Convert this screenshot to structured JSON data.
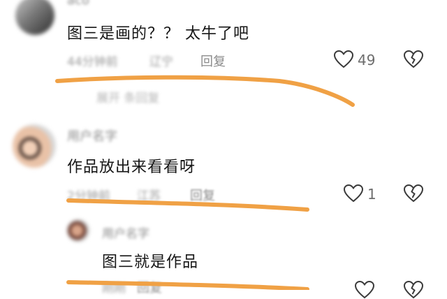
{
  "comments": [
    {
      "username": "aco",
      "text": "图三是画的？？ 太牛了吧",
      "time": "44分钟前",
      "location": "辽宁",
      "reply_label": "回复",
      "like_count": "49",
      "sub_line": "展开 条回复"
    },
    {
      "username": "用户名字",
      "text": "作品放出来看看呀",
      "time": "2分钟前",
      "location": "江苏",
      "reply_label": "回复",
      "like_count": "1"
    },
    {
      "username": "用户名字",
      "text": "图三就是作品",
      "time": "刚刚",
      "reply_label": "回复"
    }
  ],
  "colors": {
    "annotation_line": "#f0a145",
    "meta_text": "#9a9a9a"
  },
  "icons": [
    "heart-icon",
    "broken-heart-icon"
  ]
}
